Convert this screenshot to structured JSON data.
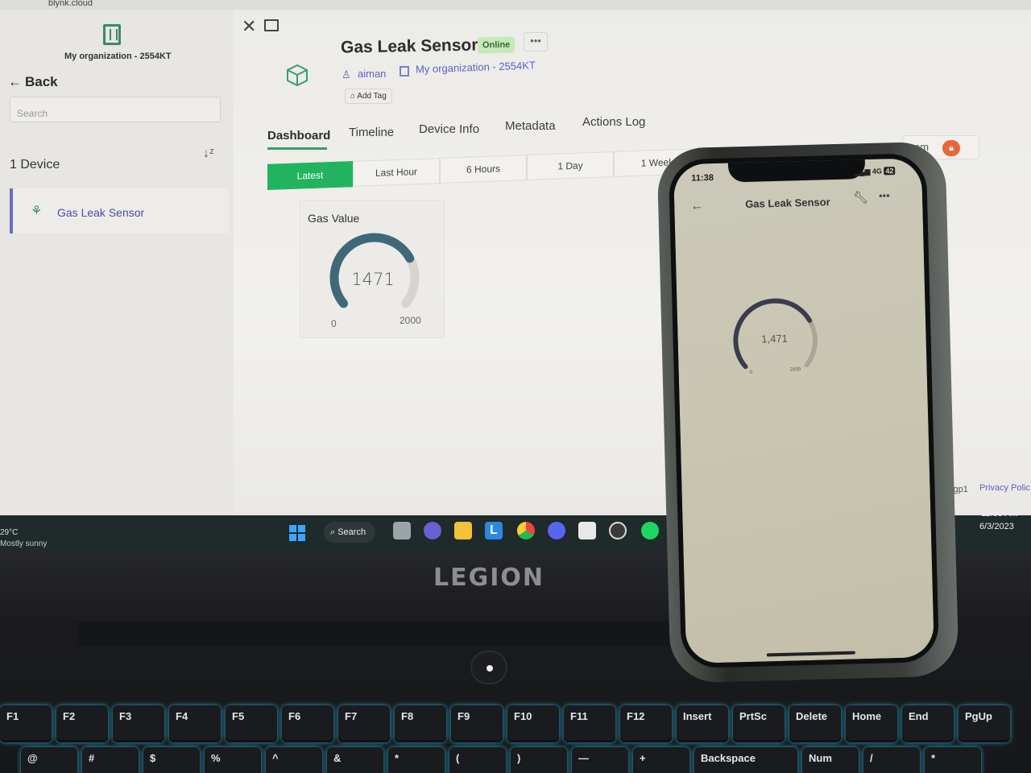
{
  "browser": {
    "url_text": "blynk.cloud"
  },
  "sidebar": {
    "org_name": "My organization - 2554KT",
    "back_label": "Back",
    "search_placeholder": "Search",
    "device_count": "1 Device",
    "devices": [
      {
        "name": "Gas Leak Sensor"
      }
    ]
  },
  "device": {
    "title": "Gas Leak Sensor",
    "status": "Online",
    "owner": "aiman",
    "org": "My organization - 2554KT",
    "add_tag": "Add Tag"
  },
  "tabs": [
    "Dashboard",
    "Timeline",
    "Device Info",
    "Metadata",
    "Actions Log"
  ],
  "time_ranges": [
    "Latest",
    "Last Hour",
    "6 Hours",
    "1 Day",
    "1 Week"
  ],
  "custom_range_label": "om",
  "widget": {
    "title": "Gas Value",
    "value": "1471",
    "min": "0",
    "max": "2000",
    "fraction": 0.7355
  },
  "footer": {
    "region": "sgp1",
    "privacy": "Privacy Polic"
  },
  "taskbar": {
    "temp": "29°C",
    "weather": "Mostly sunny",
    "search_label": "Search",
    "time": "11:38 AM",
    "date": "6/3/2023"
  },
  "laptop": {
    "brand": "LEGION"
  },
  "keyboard": {
    "row1": [
      {
        "label": "F1"
      },
      {
        "label": "F2"
      },
      {
        "label": "F3"
      },
      {
        "label": "F4"
      },
      {
        "label": "F5"
      },
      {
        "label": "F6"
      },
      {
        "label": "F7"
      },
      {
        "label": "F8"
      },
      {
        "label": "F9"
      },
      {
        "label": "F10"
      },
      {
        "label": "F11"
      },
      {
        "label": "F12"
      },
      {
        "label": "Insert"
      },
      {
        "label": "PrtSc"
      },
      {
        "label": "Delete"
      },
      {
        "label": "Home"
      },
      {
        "label": "End"
      },
      {
        "label": "PgUp"
      }
    ],
    "row2": [
      {
        "label": "@"
      },
      {
        "label": "#"
      },
      {
        "label": "$"
      },
      {
        "label": "%"
      },
      {
        "label": "^"
      },
      {
        "label": "&"
      },
      {
        "label": "*"
      },
      {
        "label": "("
      },
      {
        "label": ")"
      },
      {
        "label": "—"
      },
      {
        "label": "+"
      },
      {
        "label": "Backspace"
      },
      {
        "label": "Num"
      },
      {
        "label": "/"
      },
      {
        "label": "*"
      }
    ]
  },
  "phone": {
    "time": "11:38",
    "network": "4G",
    "battery": "42",
    "title": "Gas Leak Sensor",
    "gauge_value": "1,471",
    "gauge_min": "0",
    "gauge_max": "2000",
    "fraction": 0.7355
  },
  "colors": {
    "accent_green": "#22b35e",
    "gauge_fill": "#3f6878",
    "gauge_track": "#d5d4cf",
    "link": "#5a62c4"
  }
}
